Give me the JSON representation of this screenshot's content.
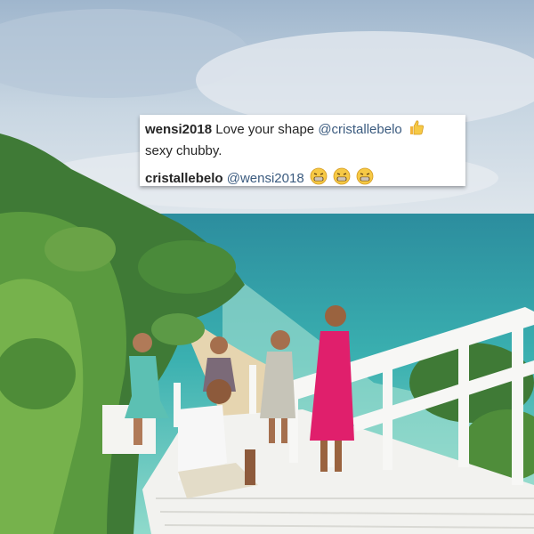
{
  "comments": [
    {
      "username": "wensi2018",
      "text_before": " Love your shape ",
      "mention": "@cristallebelo",
      "icon_after_mention": "thumbs-up-emoji",
      "text_after": "sexy chubby."
    },
    {
      "username": "cristallebelo",
      "mention": "@wensi2018",
      "emojis": [
        "grimacing-laughing-emoji",
        "grimacing-laughing-emoji",
        "grimacing-laughing-emoji"
      ]
    }
  ],
  "colors": {
    "mention": "#3b5b7f",
    "text": "#262626",
    "emoji": "#f6c945"
  }
}
